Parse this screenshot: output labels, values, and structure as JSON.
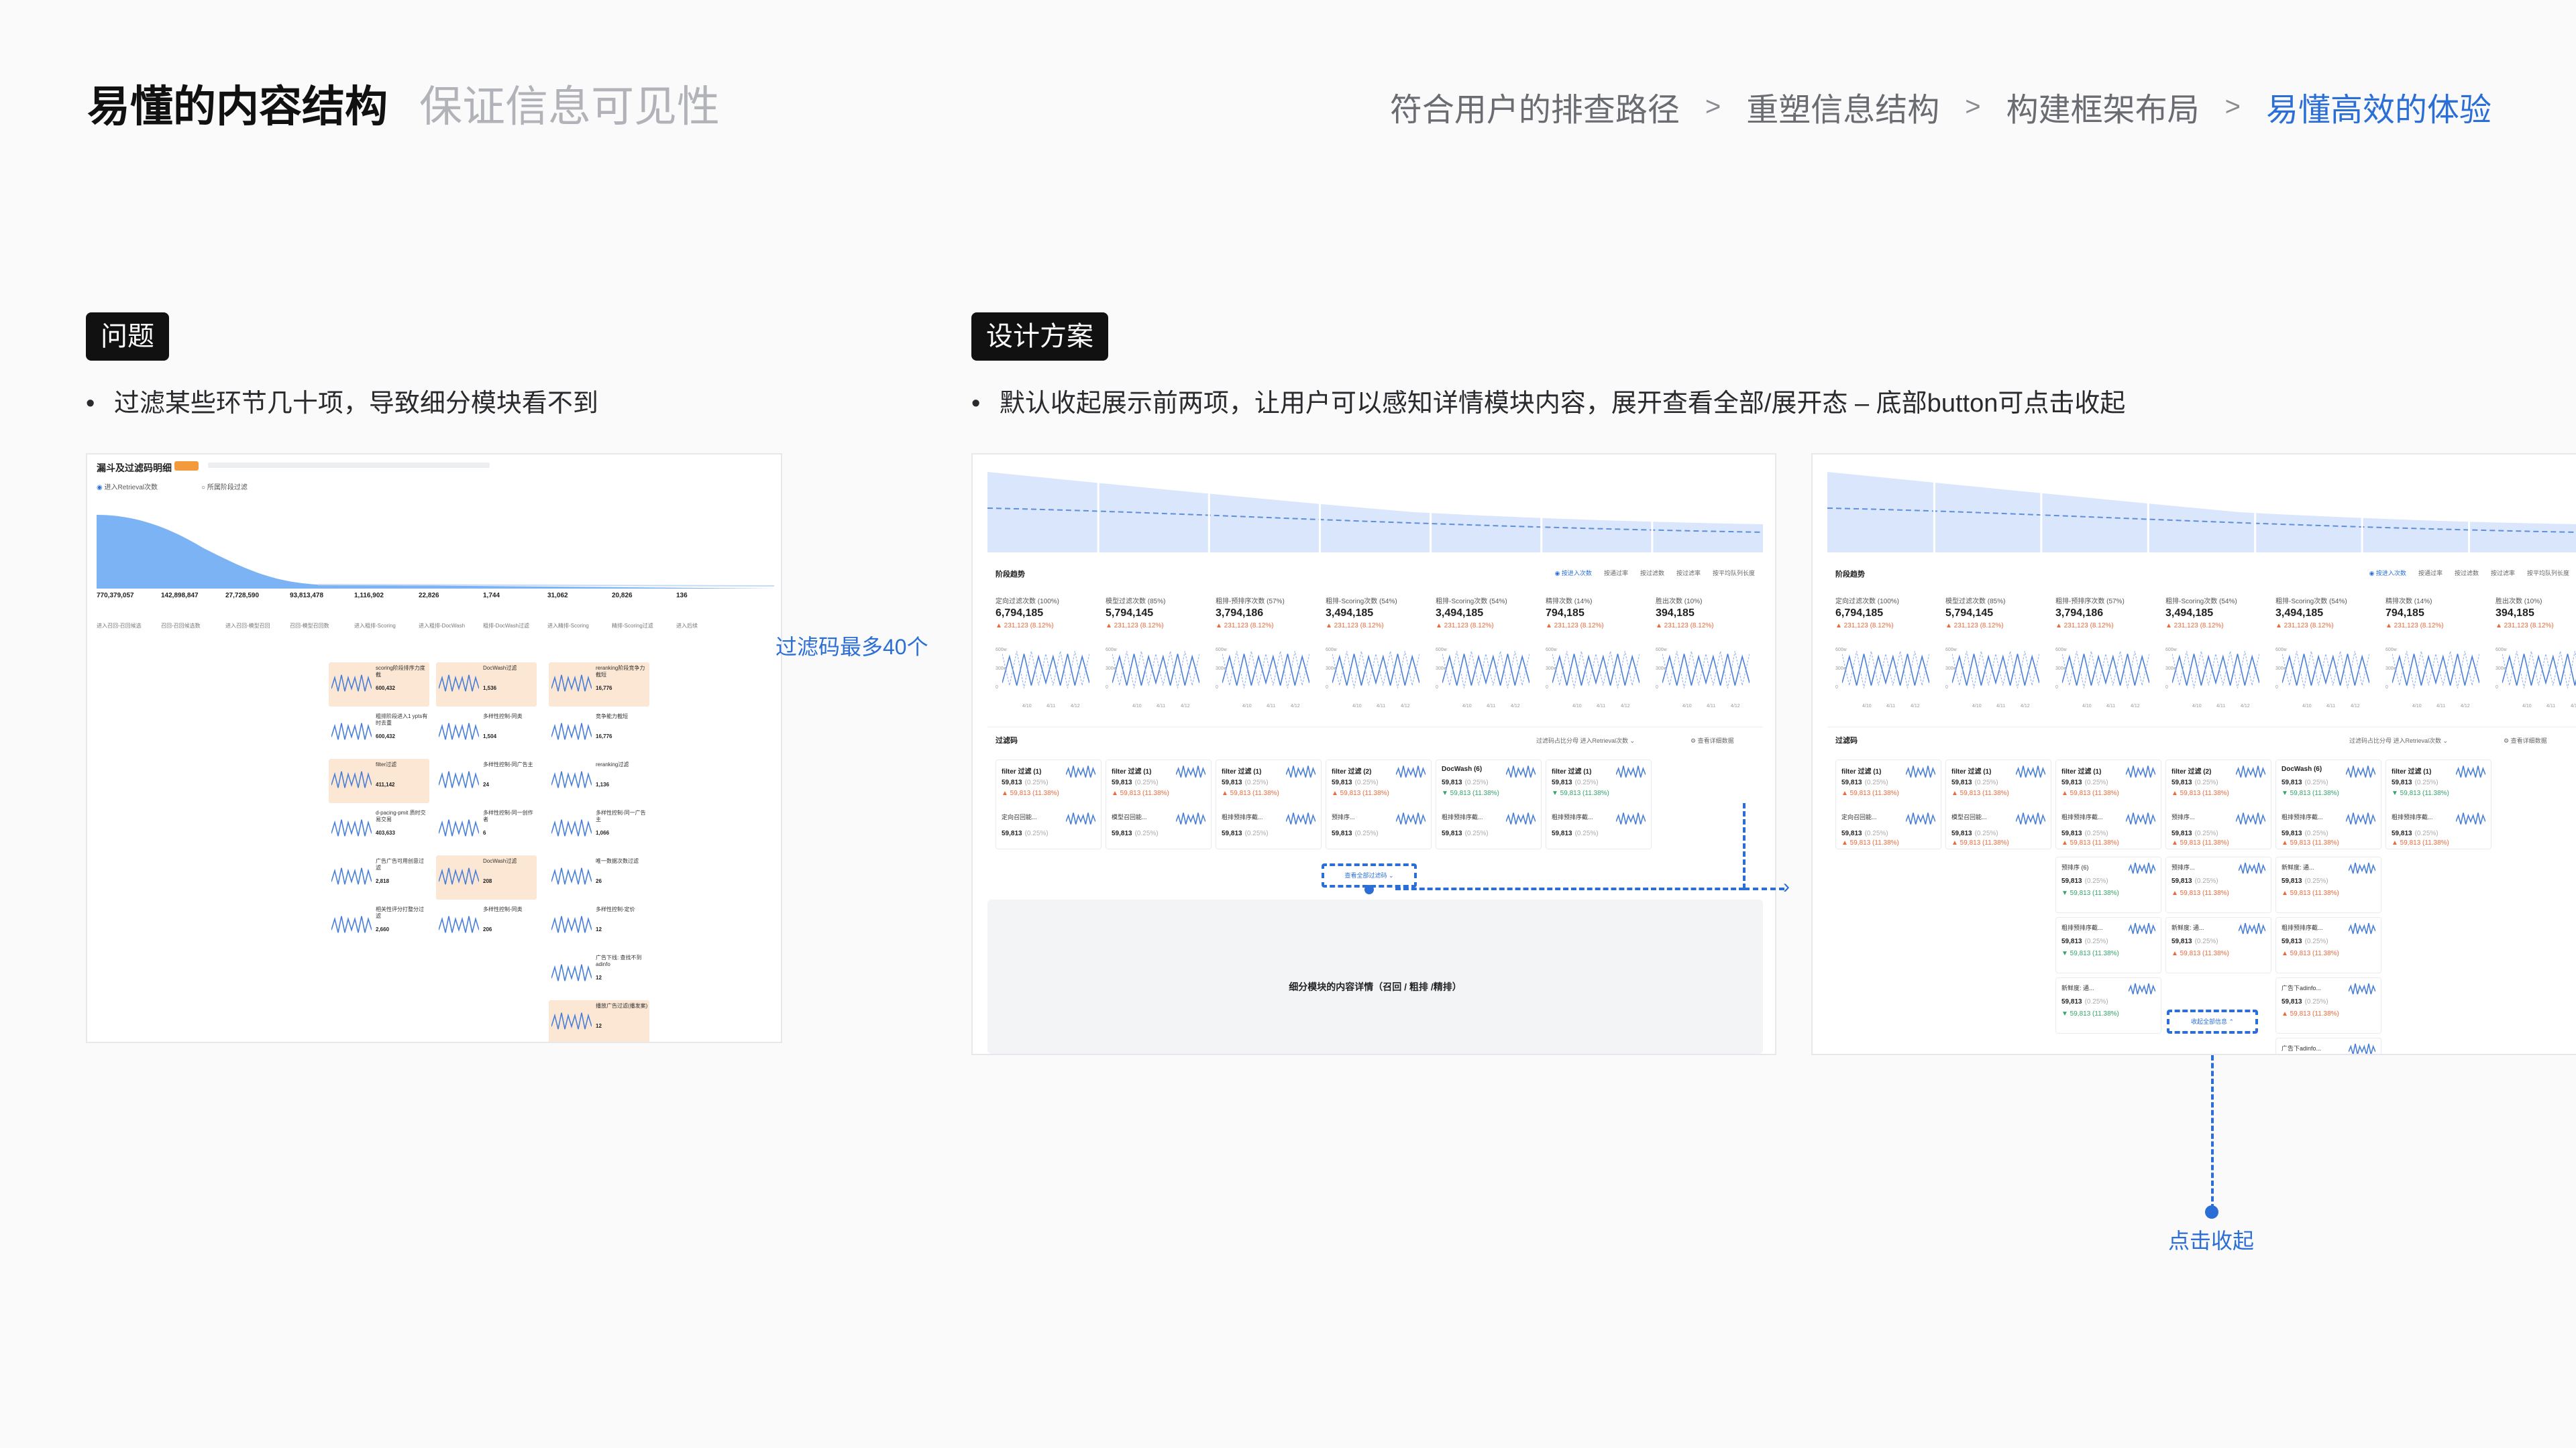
{
  "header": {
    "title": "易懂的内容结构",
    "subtitle": "保证信息可见性",
    "breadcrumb": [
      "符合用户的排查路径",
      "重塑信息结构",
      "构建框架布局",
      "易懂高效的体验"
    ],
    "separator": ">"
  },
  "problem": {
    "tag": "问题",
    "bullet": "•",
    "desc": "过滤某些环节几十项，导致细分模块看不到",
    "annotation": "过滤码最多40个",
    "screen": {
      "title": "漏斗及过滤码明细",
      "radio_a": "进入Retrieval次数",
      "radio_b": "所属阶段过滤",
      "metrics": [
        "770,379,057",
        "142,898,847",
        "27,728,590",
        "93,813,478",
        "1,116,902",
        "22,826",
        "1,744",
        "31,062",
        "20,826",
        "136"
      ],
      "labels": [
        "进入召回-召回候选",
        "召回-召回候选数",
        "进入召回-模型召回",
        "召回-模型召回数",
        "进入粗排-Scoring",
        "进入粗排-DocWash",
        "粗排-DocWash过滤",
        "进入精排-Scoring",
        "精排-Scoring过滤",
        "进入后续"
      ],
      "cards": [
        {
          "name": "scoring阶段排序力度截",
          "value": "600,432"
        },
        {
          "name": "粗排阶段进入1 ypts有时去重",
          "value": "600,432"
        },
        {
          "name": "filter过滤",
          "value": "411,142"
        },
        {
          "name": "d-pacing-pmit 质时交易交易",
          "value": "403,633"
        },
        {
          "name": "广告广告可用创意过滤",
          "value": "2,818"
        },
        {
          "name": "相关性评分打整分过滤",
          "value": "2,660"
        },
        {
          "name": "DocWash过滤",
          "value": "1,536"
        },
        {
          "name": "多样性控制-同类",
          "value": "1,504"
        },
        {
          "name": "多样性控制-同广告主",
          "value": "24"
        },
        {
          "name": "多样性控制-同一创作者",
          "value": "6"
        },
        {
          "name": "DocWash过滤",
          "value": "208"
        },
        {
          "name": "多样性控制-同类",
          "value": "206"
        },
        {
          "name": "reranking阶段竞争力截短",
          "value": "16,776"
        },
        {
          "name": "竞争能力截短",
          "value": "16,776"
        },
        {
          "name": "reranking过滤",
          "value": "1,136"
        },
        {
          "name": "多样性控制-同一广告主",
          "value": "1,066"
        },
        {
          "name": "唯一数据次数过滤",
          "value": "26"
        },
        {
          "name": "多样性控制-定价",
          "value": "12"
        },
        {
          "name": "广告下线: 查找不到 adinfo",
          "value": "12"
        },
        {
          "name": "播放广告过滤(播发案)",
          "value": "12"
        }
      ]
    }
  },
  "solution": {
    "tag": "设计方案",
    "bullet": "•",
    "desc": "默认收起展示前两项，让用户可以感知详情模块内容，展开查看全部/展开态 – 底部button可点击收起",
    "collapse_annotation": "点击收起",
    "stage_section": "阶段趋势",
    "stage_options": [
      "按进入次数",
      "按通过率",
      "按过滤数",
      "按过滤率",
      "按平均队列长度"
    ],
    "stages": [
      {
        "label": "定向过滤次数 (100%)",
        "value": "6,794,185",
        "delta": "231,123 (8.12%)"
      },
      {
        "label": "模型过滤次数 (85%)",
        "value": "5,794,145",
        "delta": "231,123 (8.12%)"
      },
      {
        "label": "粗排-预排序次数 (57%)",
        "value": "3,794,186",
        "delta": "231,123 (8.12%)"
      },
      {
        "label": "粗排-Scoring次数 (54%)",
        "value": "3,494,185",
        "delta": "231,123 (8.12%)"
      },
      {
        "label": "粗排-Scoring次数 (54%)",
        "value": "3,494,185",
        "delta": "231,123 (8.12%)"
      },
      {
        "label": "精排次数 (14%)",
        "value": "794,185",
        "delta": "231,123 (8.12%)"
      },
      {
        "label": "胜出次数 (10%)",
        "value": "394,185",
        "delta": "231,123 (8.12%)"
      }
    ],
    "x_ticks": [
      "4/10",
      "4/11",
      "4/12"
    ],
    "filter_section": "过滤码",
    "filter_tools": "过滤码占比分母  进入Retrieval次数",
    "filter_detail": "查看详细数据",
    "filter_cols": [
      {
        "head": "filter 过滤 (1)",
        "value": "59,813",
        "pct": "(0.25%)",
        "delta": "59,813 (11.38%)",
        "second": "定向召回能..."
      },
      {
        "head": "filter 过滤 (1)",
        "value": "59,813",
        "pct": "(0.25%)",
        "delta": "59,813 (11.38%)",
        "second": "模型召回能..."
      },
      {
        "head": "filter 过滤 (1)",
        "value": "59,813",
        "pct": "(0.25%)",
        "delta": "59,813 (11.38%)",
        "second": "粗排预排序截..."
      },
      {
        "head": "filter 过滤 (2)",
        "value": "59,813",
        "pct": "(0.25%)",
        "delta": "59,813 (11.38%)",
        "second": "预排序..."
      },
      {
        "head": "DocWash (6)",
        "value": "59,813",
        "pct": "(0.25%)",
        "delta": "59,813 (11.38%)",
        "second": "粗排预排序截..."
      },
      {
        "head": "filter 过滤 (1)",
        "value": "59,813",
        "pct": "(0.25%)",
        "delta": "59,813 (11.38%)",
        "second": "粗排预排序截..."
      }
    ],
    "expand_button": "查看全部过滤码 ⌄",
    "collapse_button": "收起全部信息 ⌃",
    "detail_placeholder": "细分模块的内容详情（召回 / 粗排 /精排）",
    "expanded_extra": [
      {
        "col": 2,
        "items": [
          "预排序 (6)",
          "粗排预排序截...",
          "新鲜度: 通..."
        ]
      },
      {
        "col": 3,
        "items": [
          "预排序...",
          "新鲜度: 通..."
        ]
      },
      {
        "col": 4,
        "items": [
          "新鲜度: 通...",
          "粗排预排序截...",
          "广告下adinfo...",
          "广告下adinfo..."
        ]
      }
    ]
  }
}
